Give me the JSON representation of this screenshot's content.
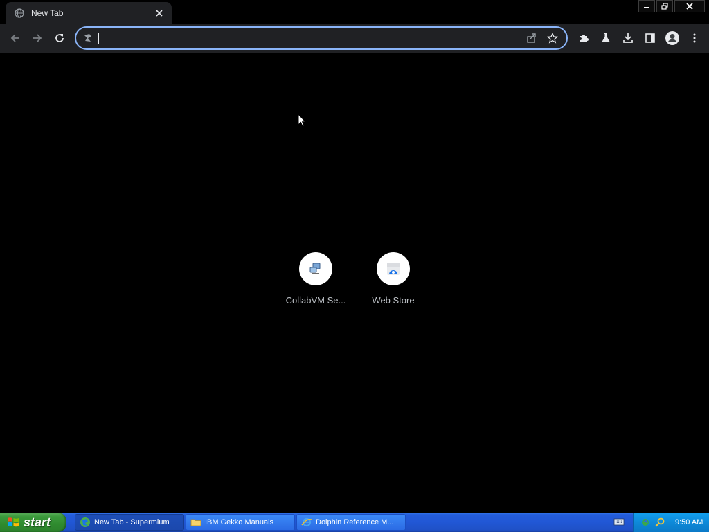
{
  "browser": {
    "tab": {
      "title": "New Tab",
      "icon": "globe-icon"
    },
    "window_controls": [
      "minimize-icon",
      "restore-icon",
      "close-icon"
    ],
    "omnibox": {
      "value": "",
      "placeholder": ""
    },
    "nav": [
      "back-icon",
      "forward-icon",
      "reload-icon"
    ],
    "toolbar_icons": [
      "extensions-icon",
      "labs-icon",
      "download-icon",
      "side-panel-icon",
      "profile-icon",
      "menu-icon"
    ],
    "omnibox_icons": [
      "share-icon",
      "bookmark-star-icon"
    ]
  },
  "shortcuts": [
    {
      "label": "CollabVM Se...",
      "icon": "collabvm-icon"
    },
    {
      "label": "Web Store",
      "icon": "web-store-icon"
    }
  ],
  "taskbar": {
    "start_label": "start",
    "items": [
      {
        "label": "New Tab - Supermium",
        "icon": "supermium-icon",
        "active": true
      },
      {
        "label": "IBM Gekko Manuals",
        "icon": "folder-icon",
        "active": false
      },
      {
        "label": "Dolphin Reference M...",
        "icon": "ie-icon",
        "active": false
      }
    ],
    "clock": "9:50 AM"
  },
  "colors": {
    "accent": "#8ab4f8",
    "toolbar": "#202124",
    "taskbar": "#245ddb",
    "start": "#3c9a3c"
  }
}
